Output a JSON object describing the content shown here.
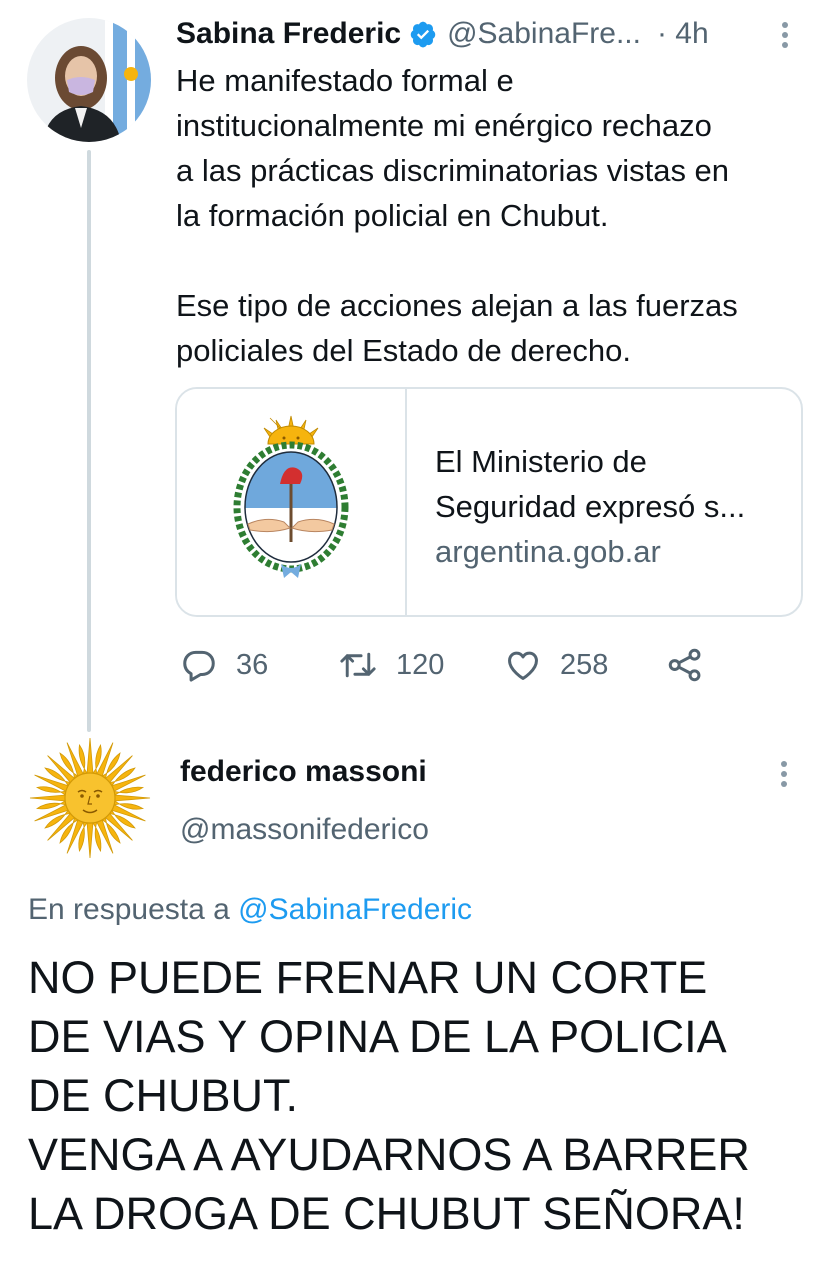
{
  "tweet1": {
    "name": "Sabina Frederic",
    "handle": "@SabinaFre...",
    "time": "· 4h",
    "body": [
      [
        "He manifestado formal e",
        "institucionalmente mi enérgico rechazo",
        "a las prácticas discriminatorias vistas en",
        "la formación policial en Chubut."
      ],
      [
        "Ese tipo de acciones alejan a las fuerzas",
        "policiales del Estado de derecho."
      ]
    ],
    "card": {
      "title_line1": "El Ministerio de",
      "title_line2": "Seguridad expresó s...",
      "domain": "argentina.gob.ar"
    },
    "actions": {
      "replies": "36",
      "retweets": "120",
      "likes": "258"
    }
  },
  "tweet2": {
    "name": "federico massoni",
    "handle": "@massonifederico",
    "reply_prefix": "En respuesta a",
    "reply_mention": "@SabinaFrederic",
    "body": [
      "NO PUEDE FRENAR UN CORTE",
      "DE VIAS Y OPINA DE LA POLICIA",
      "DE CHUBUT.",
      "VENGA A AYUDARNOS A BARRER",
      "LA DROGA DE CHUBUT SEÑORA!"
    ]
  },
  "icons": {
    "verified": "verified-badge-icon",
    "more": "more-options-icon",
    "reply": "reply-icon",
    "retweet": "retweet-icon",
    "like": "heart-icon",
    "share": "share-icon"
  },
  "colors": {
    "accent": "#1d9bf0",
    "secondary_text": "#536471",
    "primary_text": "#0f1419",
    "argentina_blue": "#74acdf",
    "sun_gold": "#f6b40e"
  }
}
